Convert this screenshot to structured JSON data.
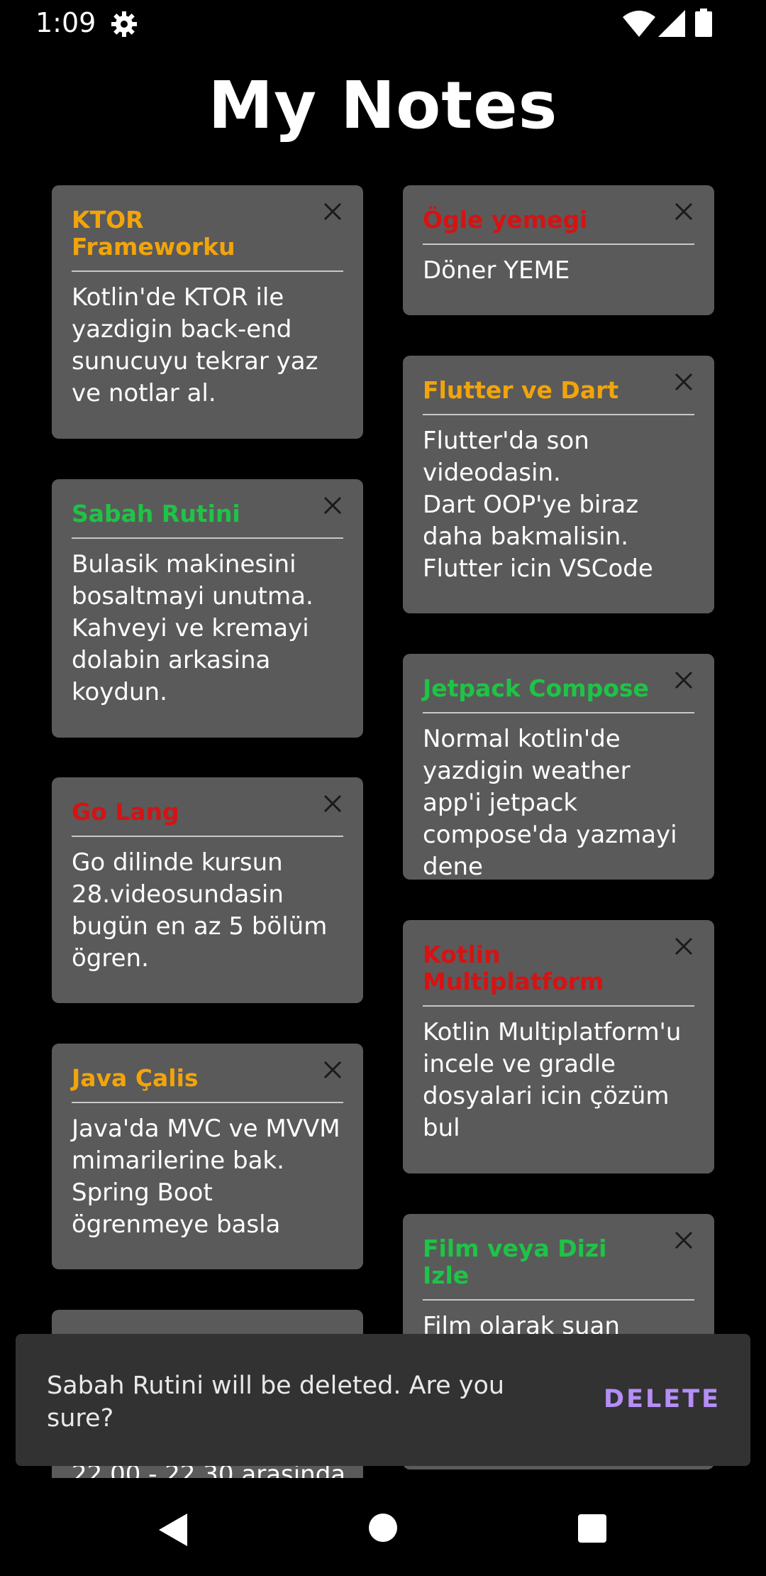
{
  "status_bar": {
    "time": "1:09",
    "icons": [
      "gear-icon",
      "wifi-icon",
      "signal-icon",
      "battery-icon"
    ]
  },
  "header": {
    "title": "My Notes"
  },
  "colors": {
    "background": "#000000",
    "card": "#5a5a5b",
    "orange": "#f2a40b",
    "green": "#1ec445",
    "red": "#d51313",
    "snackbar": "#323232",
    "snackbar_action": "#b58ef7"
  },
  "notes": [
    {
      "title": "KTOR Frameworku",
      "color": "orange",
      "body": "Kotlin'de KTOR ile yazdigin back-end sunucuyu tekrar yaz ve notlar al."
    },
    {
      "title": "Ögle yemegi",
      "color": "red",
      "body": "Döner YEME"
    },
    {
      "title": "Flutter ve Dart",
      "color": "orange",
      "body": "Flutter'da son videodasin.\nDart OOP'ye biraz daha bakmalisin.\nFlutter icin VSCode"
    },
    {
      "title": "Sabah Rutini",
      "color": "green",
      "body": "Bulasik makinesini bosaltmayi unutma.\nKahveyi ve kremayi dolabin arkasina koydun."
    },
    {
      "title": "Jetpack Compose",
      "color": "green",
      "body": "Normal kotlin'de yazdigin weather app'i jetpack compose'da yazmayi dene"
    },
    {
      "title": "Go Lang",
      "color": "red",
      "body": "Go dilinde kursun 28.videosundasin bugün en az 5 bölüm ögren."
    },
    {
      "title": "Kotlin Multiplatform",
      "color": "red",
      "body": "Kotlin Multiplatform'u incele ve gradle dosyalari icin çözüm bul"
    },
    {
      "title": "Java Çalis",
      "color": "orange",
      "body": "Java'da MVC ve MVVM mimarilerine bak.\nSpring Boot ögrenmeye basla"
    },
    {
      "title": "Film veya Dizi Izle",
      "color": "green",
      "body": "Film olarak suan"
    },
    {
      "title": "",
      "color": "orange",
      "body": "22.00 - 22.30 arasinda"
    }
  ],
  "snackbar": {
    "message": "Sabah Rutini will be deleted. Are you sure?",
    "action": "DELETE"
  },
  "nav_bar": {
    "icons": [
      "back-icon",
      "home-icon",
      "recents-icon"
    ]
  }
}
